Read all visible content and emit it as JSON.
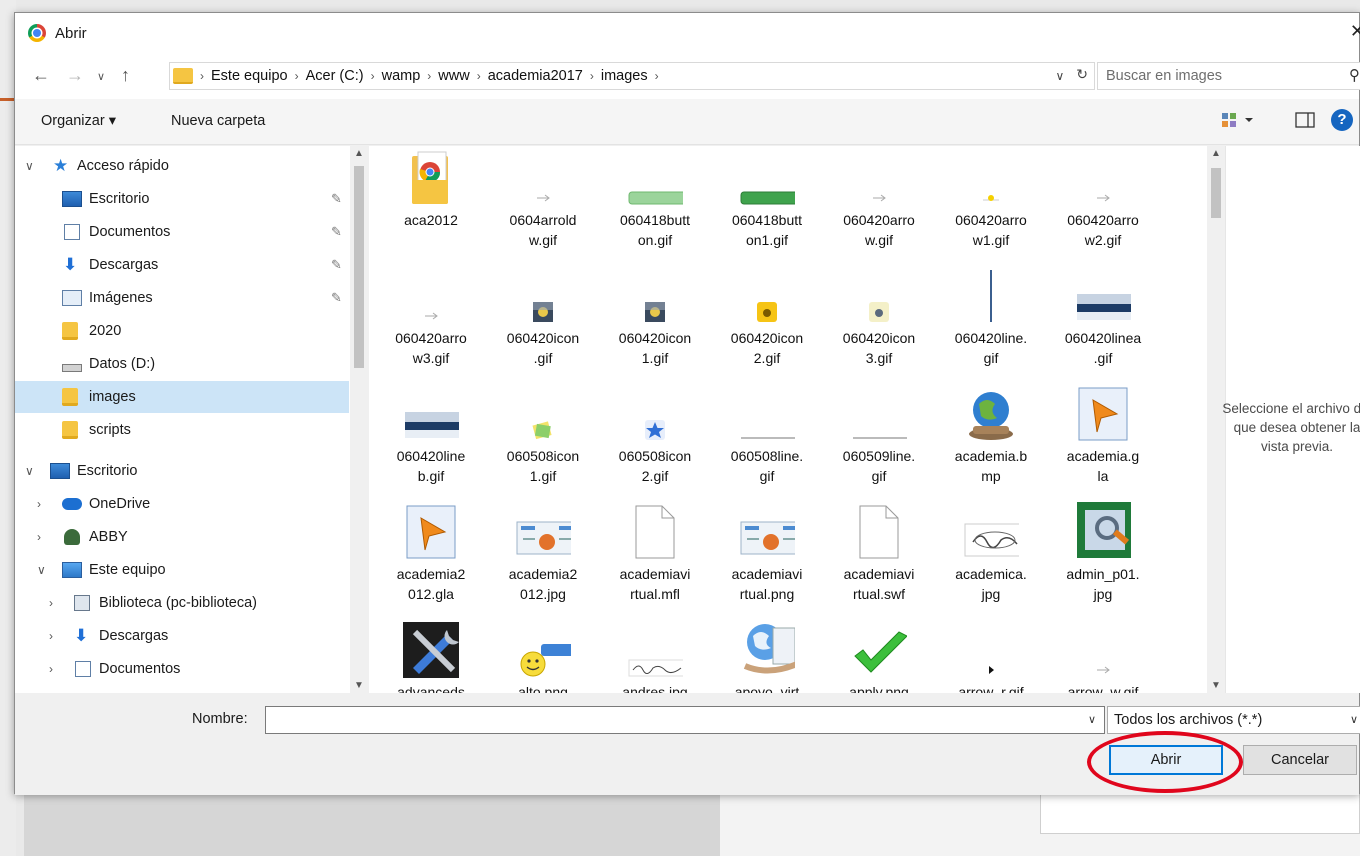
{
  "dialog": {
    "title": "Abrir",
    "close_glyph": "✕"
  },
  "address": {
    "crumbs": [
      "Este equipo",
      "Acer (C:)",
      "wamp",
      "www",
      "academia2017",
      "images"
    ],
    "search_placeholder": "Buscar en images"
  },
  "toolbar": {
    "organize": "Organizar ▾",
    "new_folder": "Nueva carpeta",
    "help": "?"
  },
  "nav": {
    "items": [
      {
        "label": "Acceso rápido",
        "icon": "star-icon"
      },
      {
        "label": "Escritorio",
        "icon": "desktop-icon"
      },
      {
        "label": "Documentos",
        "icon": "documents-icon"
      },
      {
        "label": "Descargas",
        "icon": "downloads-icon"
      },
      {
        "label": "Imágenes",
        "icon": "pictures-icon"
      },
      {
        "label": "2020",
        "icon": "folder-icon"
      },
      {
        "label": "Datos (D:)",
        "icon": "drive-icon"
      },
      {
        "label": "images",
        "icon": "folder-icon"
      },
      {
        "label": "scripts",
        "icon": "folder-icon"
      },
      {
        "label": "Escritorio",
        "icon": "desktop-icon"
      },
      {
        "label": "OneDrive",
        "icon": "cloud-icon"
      },
      {
        "label": "ABBY",
        "icon": "user-icon"
      },
      {
        "label": "Este equipo",
        "icon": "pc-icon"
      },
      {
        "label": "Biblioteca (pc-biblioteca)",
        "icon": "network-drive-icon"
      },
      {
        "label": "Descargas",
        "icon": "downloads-icon"
      },
      {
        "label": "Documentos",
        "icon": "documents-icon"
      }
    ]
  },
  "files": [
    {
      "name": "aca2012",
      "kind": "folder"
    },
    {
      "name": "0604arrold\nw.gif",
      "kind": "tiny"
    },
    {
      "name": "060418butt\non.gif",
      "kind": "greenbar-light"
    },
    {
      "name": "060418butt\non1.gif",
      "kind": "greenbar"
    },
    {
      "name": "060420arro\nw.gif",
      "kind": "tiny"
    },
    {
      "name": "060420arro\nw1.gif",
      "kind": "tiny-yellow"
    },
    {
      "name": "060420arro\nw2.gif",
      "kind": "tiny"
    },
    {
      "name": "060420arro\nw3.gif",
      "kind": "tiny"
    },
    {
      "name": "060420icon\n.gif",
      "kind": "icon-dark"
    },
    {
      "name": "060420icon\n1.gif",
      "kind": "icon-dark"
    },
    {
      "name": "060420icon\n2.gif",
      "kind": "icon-yellow"
    },
    {
      "name": "060420icon\n3.gif",
      "kind": "icon-light"
    },
    {
      "name": "060420line.\ngif",
      "kind": "vline"
    },
    {
      "name": "060420linea\n.gif",
      "kind": "gradbar"
    },
    {
      "name": "060420line\nb.gif",
      "kind": "gradbar"
    },
    {
      "name": "060508icon\n1.gif",
      "kind": "icon-note"
    },
    {
      "name": "060508icon\n2.gif",
      "kind": "icon-star"
    },
    {
      "name": "060508line.\ngif",
      "kind": "hline"
    },
    {
      "name": "060509line.\ngif",
      "kind": "hline"
    },
    {
      "name": "academia.b\nmp",
      "kind": "globe"
    },
    {
      "name": "academia.g\nla",
      "kind": "gla"
    },
    {
      "name": "academia2\n012.gla",
      "kind": "gla"
    },
    {
      "name": "academia2\n012.jpg",
      "kind": "banner"
    },
    {
      "name": "academiavi\nrtual.mfl",
      "kind": "blank"
    },
    {
      "name": "academiavi\nrtual.png",
      "kind": "banner"
    },
    {
      "name": "academiavi\nrtual.swf",
      "kind": "blank"
    },
    {
      "name": "academica.\njpg",
      "kind": "signature"
    },
    {
      "name": "admin_p01.\njpg",
      "kind": "admin"
    },
    {
      "name": "advanceds",
      "kind": "tools"
    },
    {
      "name": "alto.png",
      "kind": "smiley"
    },
    {
      "name": "andres.jpg",
      "kind": "handwriting"
    },
    {
      "name": "apoyo_virt",
      "kind": "globe2"
    },
    {
      "name": "apply.png",
      "kind": "check"
    },
    {
      "name": "arrow_r.gif",
      "kind": "tiny-black"
    },
    {
      "name": "arrow_w.gif",
      "kind": "tiny"
    }
  ],
  "preview": {
    "message": "Seleccione el archivo del que desea obtener la vista previa."
  },
  "bottom": {
    "name_label": "Nombre:",
    "name_value": "",
    "filter": "Todos los archivos (*.*)",
    "open": "Abrir",
    "cancel": "Cancelar"
  },
  "colors": {
    "selection": "#cce4f7",
    "primary_border": "#0078d7",
    "annotation_ring": "#e0061c"
  }
}
